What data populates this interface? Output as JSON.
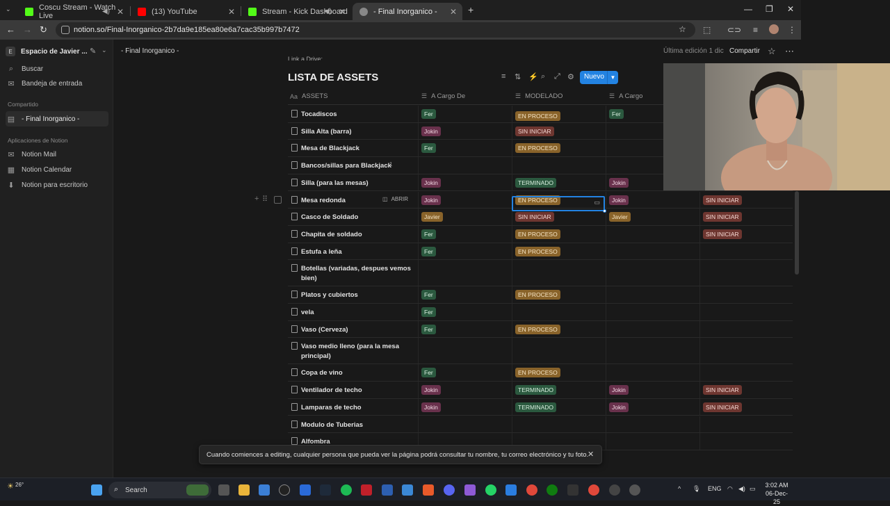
{
  "browser": {
    "tabs": [
      {
        "title": "Coscu Stream - Watch Live",
        "color": "#53fc18"
      },
      {
        "title": "(13) YouTube",
        "color": "#ff0000"
      },
      {
        "title": "Stream - Kick Dashboard",
        "color": "#53fc18"
      },
      {
        "title": "- Final Inorganico -",
        "color": "#888888"
      }
    ],
    "url": "notion.so/Final-Inorganico-2b7da9e185ea80e6a7cac35b997b7472"
  },
  "sidebar": {
    "workspace_initial": "E",
    "workspace_name": "Espacio de Javier ...",
    "search": "Buscar",
    "inbox": "Bandeja de entrada",
    "shared_header": "Compartido",
    "shared_page": "- Final Inorganico -",
    "apps_header": "Aplicaciones de Notion",
    "apps": [
      "Notion Mail",
      "Notion Calendar",
      "Notion para escritorio"
    ]
  },
  "topbar": {
    "breadcrumb": "- Final Inorganico -",
    "last_edited": "Última edición 1 dic",
    "share": "Compartir"
  },
  "database": {
    "link_text": "Link a Drive:",
    "title": "LISTA DE ASSETS",
    "new_button": "Nuevo",
    "open_label": "ABRIR",
    "columns": [
      "ASSETS",
      "A Cargo De",
      "MODELADO",
      "A Cargo"
    ],
    "rows": [
      {
        "name": "Tocadiscos",
        "owner": "Fer",
        "modelado": "EN PROCESO",
        "owner2": "Fer",
        "status2": ""
      },
      {
        "name": "Silla Alta (barra)",
        "owner": "Jokin",
        "modelado": "SIN INICIAR",
        "owner2": "",
        "status2": ""
      },
      {
        "name": "Mesa de Blackjack",
        "owner": "Fer",
        "modelado": "EN PROCESO",
        "owner2": "",
        "status2": ""
      },
      {
        "name": "Bancos/sillas para Blackjack",
        "comments": "1",
        "owner": "",
        "modelado": "",
        "owner2": "",
        "status2": ""
      },
      {
        "name": "Silla (para las mesas)",
        "owner": "Jokin",
        "modelado": "TERMINADO",
        "owner2": "Jokin",
        "status2": ""
      },
      {
        "name": "Mesa redonda",
        "owner": "Jokin",
        "modelado": "EN PROCESO",
        "owner2": "Jokin",
        "status2": "SIN INICIAR"
      },
      {
        "name": "Casco de Soldado",
        "owner": "Javier",
        "modelado": "SIN INICIAR",
        "owner2": "Javier",
        "status2": "SIN INICIAR"
      },
      {
        "name": "Chapita de soldado",
        "owner": "Fer",
        "modelado": "EN PROCESO",
        "owner2": "",
        "status2": "SIN INICIAR"
      },
      {
        "name": "Estufa a leña",
        "owner": "Fer",
        "modelado": "EN PROCESO",
        "owner2": "",
        "status2": ""
      },
      {
        "name": "Botellas (variadas, despues vemos bien)",
        "owner": "",
        "modelado": "",
        "owner2": "",
        "status2": ""
      },
      {
        "name": "Platos y cubiertos",
        "owner": "Fer",
        "modelado": "EN PROCESO",
        "owner2": "",
        "status2": ""
      },
      {
        "name": "vela",
        "owner": "Fer",
        "modelado": "",
        "owner2": "",
        "status2": ""
      },
      {
        "name": "Vaso (Cerveza)",
        "owner": "Fer",
        "modelado": "EN PROCESO",
        "owner2": "",
        "status2": ""
      },
      {
        "name": "Vaso medio lleno (para la mesa principal)",
        "owner": "",
        "modelado": "",
        "owner2": "",
        "status2": ""
      },
      {
        "name": "Copa de vino",
        "owner": "Fer",
        "modelado": "EN PROCESO",
        "owner2": "",
        "status2": ""
      },
      {
        "name": "Ventilador de techo",
        "owner": "Jokin",
        "modelado": "TERMINADO",
        "owner2": "Jokin",
        "status2": "SIN INICIAR"
      },
      {
        "name": "Lamparas de techo",
        "owner": "Jokin",
        "modelado": "TERMINADO",
        "owner2": "Jokin",
        "status2": "SIN INICIAR"
      },
      {
        "name": "Modulo de Tuberias",
        "owner": "",
        "modelado": "",
        "owner2": "",
        "status2": ""
      },
      {
        "name": "Alfombra",
        "owner": "",
        "modelado": "",
        "owner2": "",
        "status2": ""
      }
    ]
  },
  "tag_colors": {
    "Fer": {
      "bg": "#2b593f",
      "fg": "#d9eedf"
    },
    "Jokin": {
      "bg": "#69314c",
      "fg": "#f2d9e4"
    },
    "Javier": {
      "bg": "#89632a",
      "fg": "#f6e5c6"
    },
    "EN PROCESO": {
      "bg": "#89632a",
      "fg": "#f6e5c6"
    },
    "SIN INICIAR": {
      "bg": "#6e3630",
      "fg": "#f5d9d4"
    },
    "TERMINADO": {
      "bg": "#2b593f",
      "fg": "#d9eedf"
    }
  },
  "toast": {
    "message": "Cuando comiences a editing, cualquier persona que pueda ver la página podrá consultar tu nombre, tu correo electrónico y tu foto."
  },
  "taskbar": {
    "weather": "26°",
    "search": "Search",
    "language": "ENG",
    "time": "3:02 AM",
    "date": "06-Dec-25"
  }
}
